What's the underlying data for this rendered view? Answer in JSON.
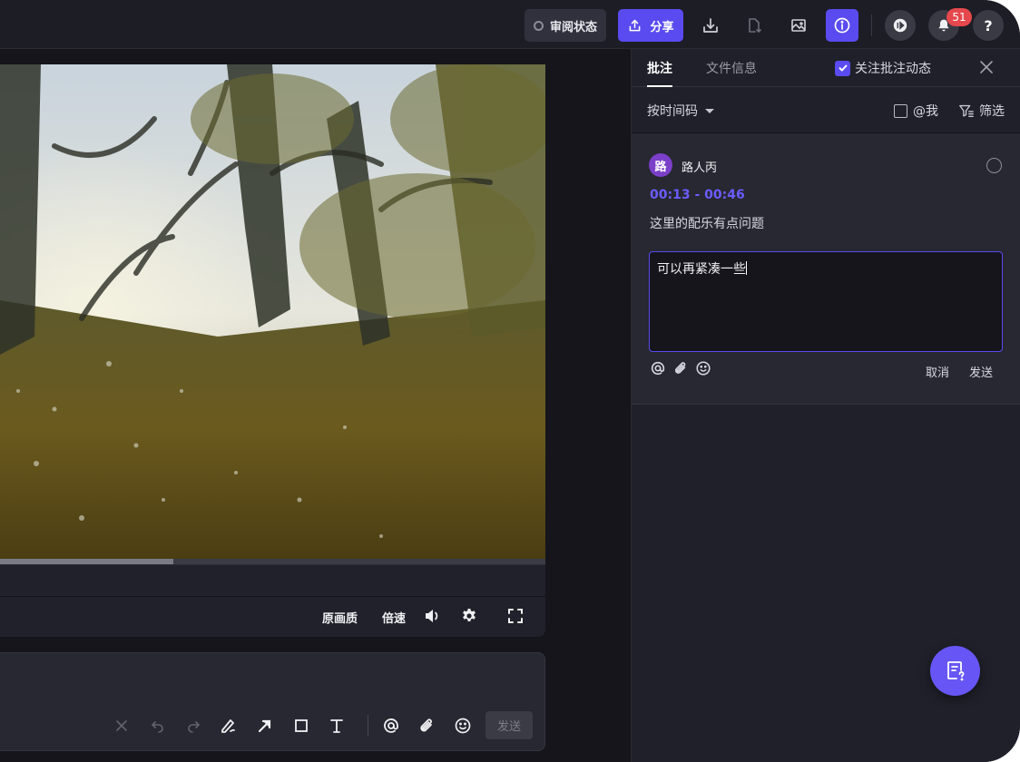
{
  "toolbar": {
    "review_status_label": "审阅状态",
    "share_label": "分享",
    "notification_count": "51",
    "help_label": "?"
  },
  "player": {
    "progress_percent": 31.7,
    "quality_label": "原画质",
    "speed_label": "倍速"
  },
  "annotation_bar": {
    "send_label": "发送"
  },
  "panel": {
    "tabs": [
      {
        "label": "批注",
        "active": true
      },
      {
        "label": "文件信息",
        "active": false
      }
    ],
    "follow_label": "关注批注动态",
    "follow_checked": true,
    "sort_label": "按时间码",
    "at_me_label": "@我",
    "filter_label": "筛选"
  },
  "comment": {
    "avatar_initial": "路",
    "user_name": "路人丙",
    "timecode": "00:13 - 00:46",
    "text": "这里的配乐有点问题",
    "reply_value": "可以再紧凑一些",
    "cancel_label": "取消",
    "send_label": "发送"
  },
  "colors": {
    "accent": "#5a4bf0",
    "timecode": "#6b5cff",
    "badge": "#e5484d",
    "avatar": "#7b3fc8"
  }
}
